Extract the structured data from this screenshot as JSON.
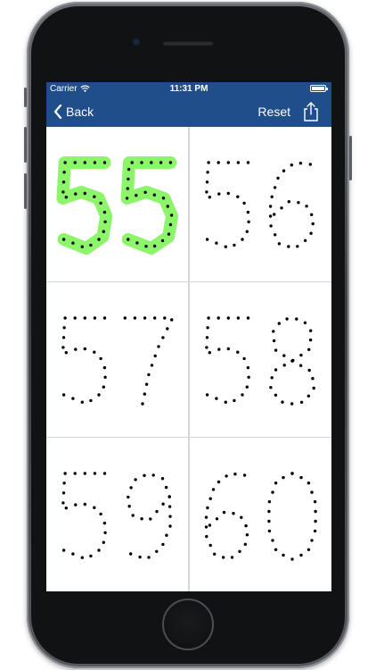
{
  "status_bar": {
    "carrier": "Carrier",
    "time": "11:31 PM"
  },
  "nav": {
    "back_label": "Back",
    "reset_label": "Reset",
    "share_icon": "share-icon"
  },
  "colors": {
    "nav_background": "#1f4e8a",
    "trace_highlight": "#8cf56a",
    "dot": "#000000"
  },
  "worksheet": {
    "cells": [
      {
        "number": "55",
        "traced": true
      },
      {
        "number": "56",
        "traced": false
      },
      {
        "number": "57",
        "traced": false
      },
      {
        "number": "58",
        "traced": false
      },
      {
        "number": "59",
        "traced": false
      },
      {
        "number": "60",
        "traced": false
      }
    ]
  }
}
